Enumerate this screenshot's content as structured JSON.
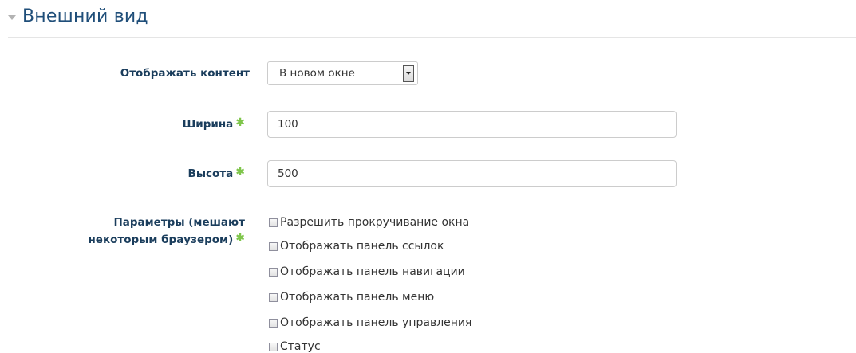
{
  "section": {
    "title": "Внешний вид"
  },
  "display": {
    "label": "Отображать контент",
    "selected": "В новом окне"
  },
  "width": {
    "label": "Ширина",
    "value": "100",
    "required_mark": "✱"
  },
  "height": {
    "label": "Высота",
    "value": "500",
    "required_mark": "✱"
  },
  "options": {
    "label_line1": "Параметры (мешают",
    "label_line2": "некоторым браузером)",
    "required_mark": "✱",
    "items": [
      {
        "label": "Разрешить прокручивание окна",
        "checked": false
      },
      {
        "label": "Отображать панель ссылок",
        "checked": false
      },
      {
        "label": "Отображать панель навигации",
        "checked": false
      },
      {
        "label": "Отображать панель меню",
        "checked": false
      },
      {
        "label": "Отображать панель управления",
        "checked": false
      },
      {
        "label": "Статус",
        "checked": false
      }
    ]
  },
  "colors": {
    "title": "#1f4e79",
    "label": "#1a3d5c",
    "required": "#7ec54a"
  }
}
